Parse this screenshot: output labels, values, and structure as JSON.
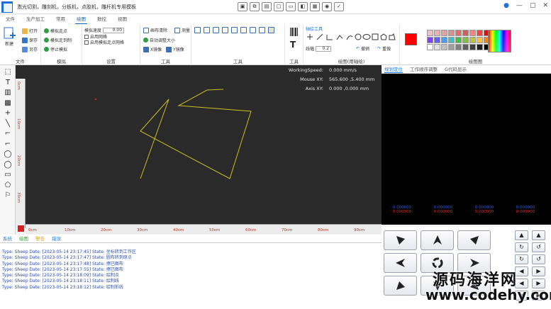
{
  "window": {
    "title": "激光切割，雕刻机，分板机，点胶机，雕杆机专用模板",
    "quick_icons": [
      "▣",
      "⧉",
      "▤",
      "▢",
      "▭",
      "◧",
      "▦",
      "◉",
      "✓"
    ]
  },
  "menu": {
    "items": [
      "文件",
      "生产加工",
      "常用",
      "绘图",
      "数控",
      "视图"
    ],
    "active": "绘图"
  },
  "ribbon": {
    "file": {
      "label": "文件",
      "new": "新建",
      "open": "打开",
      "save": "保存",
      "save_as": "另存"
    },
    "sim": {
      "label": "模拟",
      "start": "模拟走点",
      "step": "模拟走到制",
      "stop": "停止模拟"
    },
    "settings": {
      "label": "设置",
      "speed_label": "模拟速度",
      "speed_value": "0.00",
      "show_grid": "启用网格",
      "mesh_move": "启用模拟走点网格"
    },
    "tools1": {
      "label": "工具",
      "clear": "画布清除",
      "measure": "测量",
      "autofit": "自动调整大小",
      "mirror_x": "X镜像",
      "mirror_y": "Y镜像"
    },
    "tools2": {
      "label": "工具"
    },
    "tools3": {
      "label": "工具"
    },
    "draw": {
      "label": "绘图(用轴绘)",
      "aux": "轴绘工具",
      "width_label": "线幅",
      "width_value": "0.2",
      "undo": "撤销",
      "redo": "重做"
    },
    "palette": {
      "label": "绘图图",
      "primary": "#ff0000",
      "colors": [
        "#f0c0c0",
        "#e8b0b0",
        "#e6a0a0",
        "#d89090",
        "#e07070",
        "#d06060",
        "#ff8080",
        "#ff4040",
        "#ff0000",
        "#8040ff",
        "#6060ff",
        "#40a0ff",
        "#40c0c0",
        "#40c040",
        "#80c040",
        "#c0c040",
        "#ffc040",
        "#ff8000",
        "#ffffff",
        "#e0e0e0",
        "#c0c0c0",
        "#a0a0a0",
        "#808080",
        "#606060",
        "#404040",
        "#202020",
        "#000000"
      ]
    }
  },
  "left_tools": [
    "⬚",
    "T",
    "▥",
    "▩",
    "+",
    "╲",
    "⌐",
    "⌐",
    "◯",
    "◯",
    "▭",
    "⬠",
    "⚐"
  ],
  "canvas": {
    "working_speed_label": "WorkingSpeed:",
    "working_speed_value": "0.000 mm/s",
    "mouse_label": "Mouse XY:",
    "mouse_value": "565.600 ,5.400 mm",
    "axis_label": "Axis XY:",
    "axis_value": "0.000 ,0.000 mm",
    "hruler": [
      "0cm",
      "10cm",
      "20cm",
      "30cm",
      "40cm",
      "50cm",
      "60cm",
      "70cm",
      "80cm",
      "90cm"
    ],
    "vruler": [
      "0cm",
      "10cm",
      "20cm",
      "30cm"
    ]
  },
  "bottom_tabs": [
    "系统",
    "绘图",
    "警告",
    "错误"
  ],
  "log": [
    "Type: Sheep  Date: [2023-05-14 23:17:45]  State: 坐标转到工作区",
    "Type: Sheep  Date: [2023-05-14 23:17:47]  State: 圆布转到原点",
    "Type: Sheep  Date: [2023-05-14 23:17:48]  State: 擦已图布",
    "Type: Sheep  Date: [2023-05-14 23:17:55]  State: 擦已图布",
    "Type: Sheep  Date: [2023-05-14 23:18:09]  State: 绘制点",
    "Type: Sheep  Date: [2023-05-14 23:18:11]  State: 绘制线",
    "Type: Sheep  Date: [2023-05-14 23:18:12]  State: 绘制折线"
  ],
  "right_tabs": [
    "规划定位",
    "工作顺序调整",
    "G代码显示"
  ],
  "axis_values": [
    {
      "a": "0.000000",
      "b": "0.000000"
    },
    {
      "a": "0.000000",
      "b": "0.000000"
    },
    {
      "a": "0.000000",
      "b": "0.000000"
    },
    {
      "a": "0.000000",
      "b": "0.000000"
    }
  ],
  "watermark": {
    "line1": "源码海洋网",
    "line2": "www.codehy.com"
  }
}
